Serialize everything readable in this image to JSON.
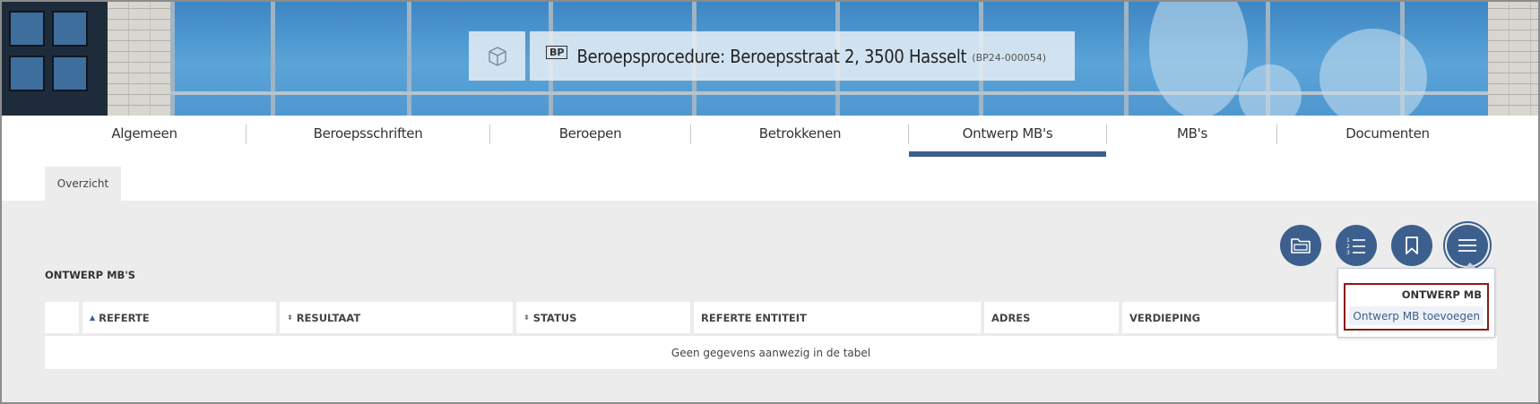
{
  "header": {
    "badge": "BP",
    "title": "Beroepsprocedure: Beroepsstraat 2, 3500 Hasselt",
    "reference": "(BP24-000054)",
    "icon": "box-icon"
  },
  "tabs": [
    {
      "label": "Algemeen",
      "active": false
    },
    {
      "label": "Beroepsschriften",
      "active": false
    },
    {
      "label": "Beroepen",
      "active": false
    },
    {
      "label": "Betrokkenen",
      "active": false
    },
    {
      "label": "Ontwerp MB's",
      "active": true
    },
    {
      "label": "MB's",
      "active": false
    },
    {
      "label": "Documenten",
      "active": false
    }
  ],
  "subtab": {
    "label": "Overzicht"
  },
  "section": {
    "title": "ONTWERP MB'S"
  },
  "actions": [
    {
      "icon": "folder-icon"
    },
    {
      "icon": "numbered-list-icon"
    },
    {
      "icon": "bookmark-icon"
    },
    {
      "icon": "menu-icon"
    }
  ],
  "table": {
    "columns": [
      "REFERTE",
      "RESULTAAT",
      "STATUS",
      "REFERTE ENTITEIT",
      "ADRES",
      "VERDIEPING"
    ],
    "empty_message": "Geen gegevens aanwezig in de tabel"
  },
  "dropdown": {
    "header": "ONTWERP MB",
    "item": "Ontwerp MB toevoegen"
  },
  "colors": {
    "accent": "#3c5f8e",
    "highlight_border": "#8b1a1a",
    "content_bg": "#ececec"
  }
}
